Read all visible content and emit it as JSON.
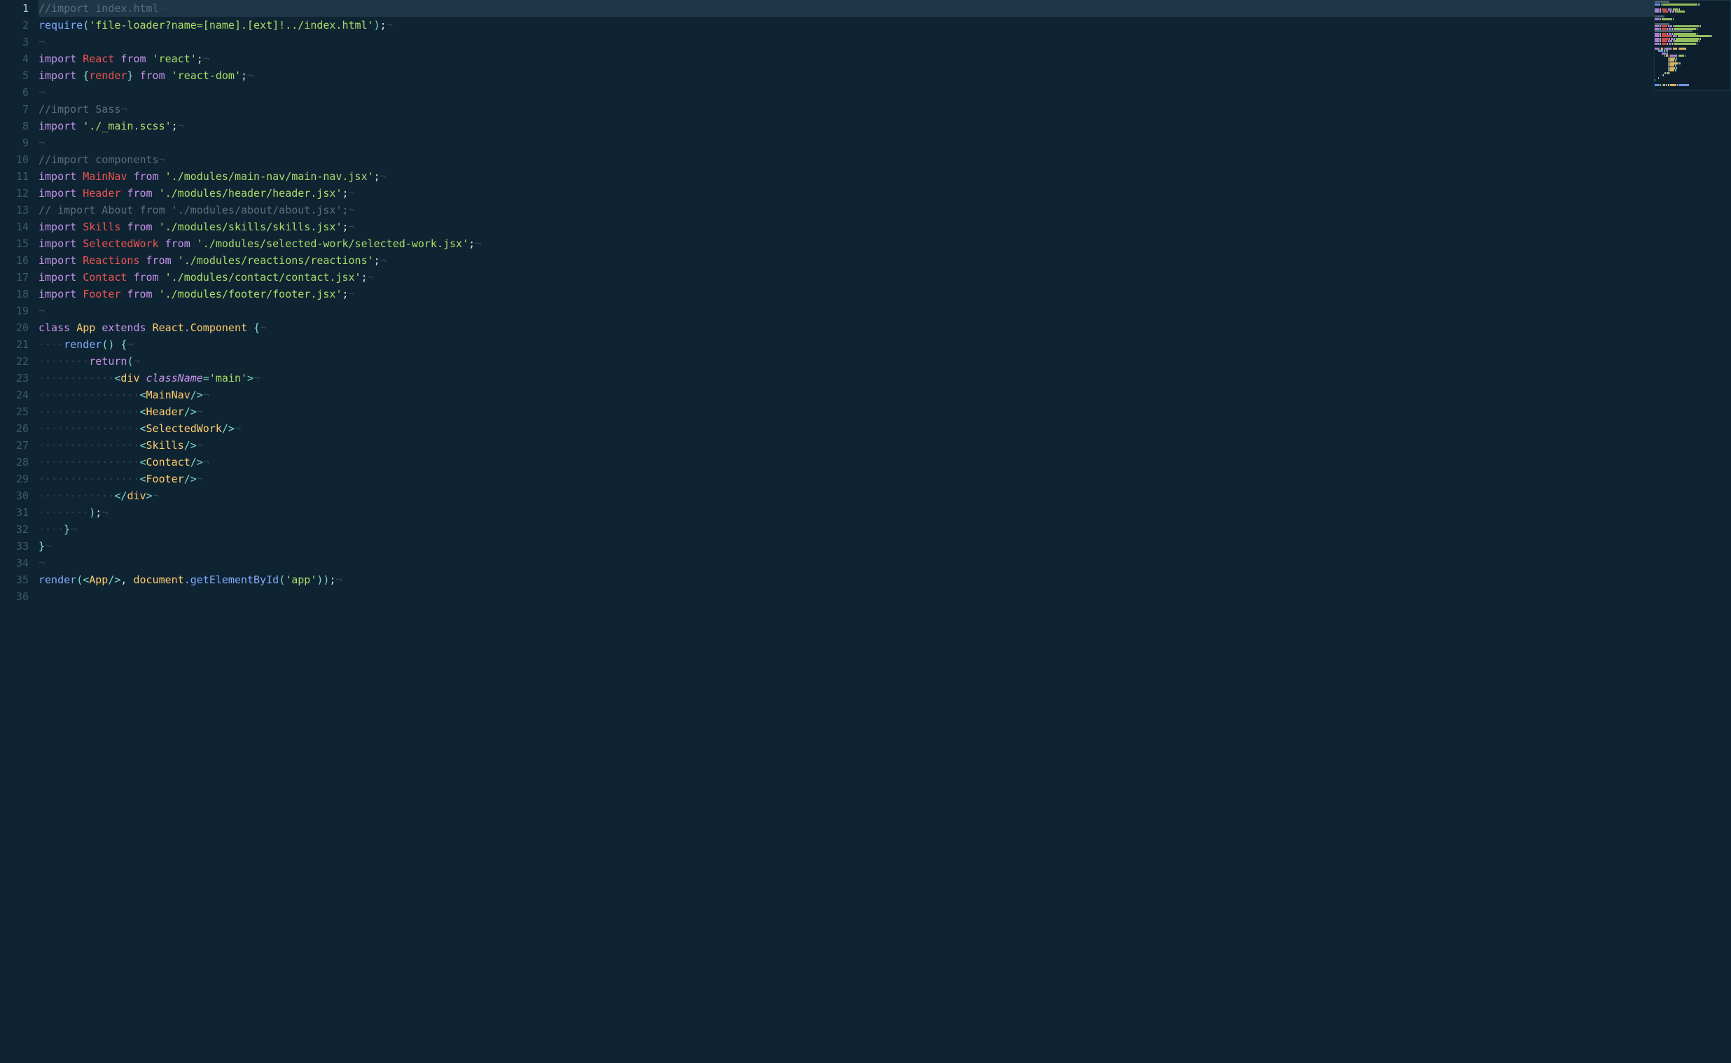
{
  "editor": {
    "activeLine": 1,
    "language": "javascript",
    "totalLines": 36
  },
  "lines": {
    "1": {
      "num": "1",
      "tokens": [
        [
          "c-comment",
          "//import index.html"
        ],
        [
          "c-eol",
          "¬"
        ]
      ]
    },
    "2": {
      "num": "2",
      "tokens": [
        [
          "c-func",
          "require"
        ],
        [
          "c-punct",
          "("
        ],
        [
          "c-string",
          "'file-loader?name=[name].[ext]!../index.html'"
        ],
        [
          "c-punct",
          ")"
        ],
        [
          "c-plain",
          ";"
        ],
        [
          "c-eol",
          "¬"
        ]
      ]
    },
    "3": {
      "num": "3",
      "tokens": [
        [
          "c-eol",
          "¬"
        ]
      ]
    },
    "4": {
      "num": "4",
      "tokens": [
        [
          "c-keyword",
          "import"
        ],
        [
          "c-plain",
          " "
        ],
        [
          "c-ident",
          "React"
        ],
        [
          "c-plain",
          " "
        ],
        [
          "c-keyword",
          "from"
        ],
        [
          "c-plain",
          " "
        ],
        [
          "c-string",
          "'react'"
        ],
        [
          "c-plain",
          ";"
        ],
        [
          "c-eol",
          "¬"
        ]
      ]
    },
    "5": {
      "num": "5",
      "tokens": [
        [
          "c-keyword",
          "import"
        ],
        [
          "c-plain",
          " "
        ],
        [
          "c-punct",
          "{"
        ],
        [
          "c-ident",
          "render"
        ],
        [
          "c-punct",
          "}"
        ],
        [
          "c-plain",
          " "
        ],
        [
          "c-keyword",
          "from"
        ],
        [
          "c-plain",
          " "
        ],
        [
          "c-string",
          "'react-dom'"
        ],
        [
          "c-plain",
          ";"
        ],
        [
          "c-eol",
          "¬"
        ]
      ]
    },
    "6": {
      "num": "6",
      "tokens": [
        [
          "c-eol",
          "¬"
        ]
      ]
    },
    "7": {
      "num": "7",
      "tokens": [
        [
          "c-comment",
          "//import Sass"
        ],
        [
          "c-eol",
          "¬"
        ]
      ]
    },
    "8": {
      "num": "8",
      "tokens": [
        [
          "c-keyword",
          "import"
        ],
        [
          "c-plain",
          " "
        ],
        [
          "c-string",
          "'./_main.scss'"
        ],
        [
          "c-plain",
          ";"
        ],
        [
          "c-eol",
          "¬"
        ]
      ]
    },
    "9": {
      "num": "9",
      "tokens": [
        [
          "c-eol",
          "¬"
        ]
      ]
    },
    "10": {
      "num": "10",
      "tokens": [
        [
          "c-comment",
          "//import components"
        ],
        [
          "c-eol",
          "¬"
        ]
      ]
    },
    "11": {
      "num": "11",
      "tokens": [
        [
          "c-keyword",
          "import"
        ],
        [
          "c-plain",
          " "
        ],
        [
          "c-ident",
          "MainNav"
        ],
        [
          "c-plain",
          " "
        ],
        [
          "c-keyword",
          "from"
        ],
        [
          "c-plain",
          " "
        ],
        [
          "c-string",
          "'./modules/main-nav/main-nav.jsx'"
        ],
        [
          "c-plain",
          ";"
        ],
        [
          "c-eol",
          "¬"
        ]
      ]
    },
    "12": {
      "num": "12",
      "tokens": [
        [
          "c-keyword",
          "import"
        ],
        [
          "c-plain",
          " "
        ],
        [
          "c-ident",
          "Header"
        ],
        [
          "c-plain",
          " "
        ],
        [
          "c-keyword",
          "from"
        ],
        [
          "c-plain",
          " "
        ],
        [
          "c-string",
          "'./modules/header/header.jsx'"
        ],
        [
          "c-plain",
          ";"
        ],
        [
          "c-eol",
          "¬"
        ]
      ]
    },
    "13": {
      "num": "13",
      "tokens": [
        [
          "c-comment",
          "// import About from './modules/about/about.jsx';"
        ],
        [
          "c-eol",
          "¬"
        ]
      ]
    },
    "14": {
      "num": "14",
      "tokens": [
        [
          "c-keyword",
          "import"
        ],
        [
          "c-plain",
          " "
        ],
        [
          "c-ident",
          "Skills"
        ],
        [
          "c-plain",
          " "
        ],
        [
          "c-keyword",
          "from"
        ],
        [
          "c-plain",
          " "
        ],
        [
          "c-string",
          "'./modules/skills/skills.jsx'"
        ],
        [
          "c-plain",
          ";"
        ],
        [
          "c-eol",
          "¬"
        ]
      ]
    },
    "15": {
      "num": "15",
      "tokens": [
        [
          "c-keyword",
          "import"
        ],
        [
          "c-plain",
          " "
        ],
        [
          "c-ident",
          "SelectedWork"
        ],
        [
          "c-plain",
          " "
        ],
        [
          "c-keyword",
          "from"
        ],
        [
          "c-plain",
          " "
        ],
        [
          "c-string",
          "'./modules/selected-work/selected-work.jsx'"
        ],
        [
          "c-plain",
          ";"
        ],
        [
          "c-eol",
          "¬"
        ]
      ]
    },
    "16": {
      "num": "16",
      "tokens": [
        [
          "c-keyword",
          "import"
        ],
        [
          "c-plain",
          " "
        ],
        [
          "c-ident",
          "Reactions"
        ],
        [
          "c-plain",
          " "
        ],
        [
          "c-keyword",
          "from"
        ],
        [
          "c-plain",
          " "
        ],
        [
          "c-string",
          "'./modules/reactions/reactions'"
        ],
        [
          "c-plain",
          ";"
        ],
        [
          "c-eol",
          "¬"
        ]
      ]
    },
    "17": {
      "num": "17",
      "tokens": [
        [
          "c-keyword",
          "import"
        ],
        [
          "c-plain",
          " "
        ],
        [
          "c-ident",
          "Contact"
        ],
        [
          "c-plain",
          " "
        ],
        [
          "c-keyword",
          "from"
        ],
        [
          "c-plain",
          " "
        ],
        [
          "c-string",
          "'./modules/contact/contact.jsx'"
        ],
        [
          "c-plain",
          ";"
        ],
        [
          "c-eol",
          "¬"
        ]
      ]
    },
    "18": {
      "num": "18",
      "tokens": [
        [
          "c-keyword",
          "import"
        ],
        [
          "c-plain",
          " "
        ],
        [
          "c-ident",
          "Footer"
        ],
        [
          "c-plain",
          " "
        ],
        [
          "c-keyword",
          "from"
        ],
        [
          "c-plain",
          " "
        ],
        [
          "c-string",
          "'./modules/footer/footer.jsx'"
        ],
        [
          "c-plain",
          ";"
        ],
        [
          "c-eol",
          "¬"
        ]
      ]
    },
    "19": {
      "num": "19",
      "tokens": [
        [
          "c-eol",
          "¬"
        ]
      ]
    },
    "20": {
      "num": "20",
      "tokens": [
        [
          "c-keyword",
          "class"
        ],
        [
          "c-plain",
          " "
        ],
        [
          "c-class",
          "App"
        ],
        [
          "c-plain",
          " "
        ],
        [
          "c-keyword",
          "extends"
        ],
        [
          "c-plain",
          " "
        ],
        [
          "c-class",
          "React"
        ],
        [
          "c-dot",
          "."
        ],
        [
          "c-class",
          "Component"
        ],
        [
          "c-plain",
          " "
        ],
        [
          "c-punct",
          "{"
        ],
        [
          "c-eol",
          "¬"
        ]
      ]
    },
    "21": {
      "num": "21",
      "tokens": [
        [
          "c-ws",
          "····"
        ],
        [
          "c-func",
          "render"
        ],
        [
          "c-punct",
          "()"
        ],
        [
          "c-plain",
          " "
        ],
        [
          "c-punct",
          "{"
        ],
        [
          "c-eol",
          "¬"
        ]
      ]
    },
    "22": {
      "num": "22",
      "tokens": [
        [
          "c-ws",
          "········"
        ],
        [
          "c-keyword",
          "return"
        ],
        [
          "c-punct",
          "("
        ],
        [
          "c-eol",
          "¬"
        ]
      ]
    },
    "23": {
      "num": "23",
      "tokens": [
        [
          "c-ws",
          "············"
        ],
        [
          "c-punct",
          "<"
        ],
        [
          "c-tag",
          "div"
        ],
        [
          "c-plain",
          " "
        ],
        [
          "c-attr",
          "className"
        ],
        [
          "c-punct",
          "="
        ],
        [
          "c-string",
          "'main'"
        ],
        [
          "c-punct",
          ">"
        ],
        [
          "c-eol",
          "¬"
        ]
      ]
    },
    "24": {
      "num": "24",
      "tokens": [
        [
          "c-ws",
          "················"
        ],
        [
          "c-punct",
          "<"
        ],
        [
          "c-tag",
          "MainNav"
        ],
        [
          "c-punct",
          "/>"
        ],
        [
          "c-eol",
          "¬"
        ]
      ]
    },
    "25": {
      "num": "25",
      "tokens": [
        [
          "c-ws",
          "················"
        ],
        [
          "c-punct",
          "<"
        ],
        [
          "c-tag",
          "Header"
        ],
        [
          "c-punct",
          "/>"
        ],
        [
          "c-eol",
          "¬"
        ]
      ]
    },
    "26": {
      "num": "26",
      "tokens": [
        [
          "c-ws",
          "················"
        ],
        [
          "c-punct",
          "<"
        ],
        [
          "c-tag",
          "SelectedWork"
        ],
        [
          "c-punct",
          "/>"
        ],
        [
          "c-eol",
          "¬"
        ]
      ]
    },
    "27": {
      "num": "27",
      "tokens": [
        [
          "c-ws",
          "················"
        ],
        [
          "c-punct",
          "<"
        ],
        [
          "c-tag",
          "Skills"
        ],
        [
          "c-punct",
          "/>"
        ],
        [
          "c-eol",
          "¬"
        ]
      ]
    },
    "28": {
      "num": "28",
      "tokens": [
        [
          "c-ws",
          "················"
        ],
        [
          "c-punct",
          "<"
        ],
        [
          "c-tag",
          "Contact"
        ],
        [
          "c-punct",
          "/>"
        ],
        [
          "c-eol",
          "¬"
        ]
      ]
    },
    "29": {
      "num": "29",
      "tokens": [
        [
          "c-ws",
          "················"
        ],
        [
          "c-punct",
          "<"
        ],
        [
          "c-tag",
          "Footer"
        ],
        [
          "c-punct",
          "/>"
        ],
        [
          "c-eol",
          "¬"
        ]
      ]
    },
    "30": {
      "num": "30",
      "tokens": [
        [
          "c-ws",
          "············"
        ],
        [
          "c-punct",
          "</"
        ],
        [
          "c-tag",
          "div"
        ],
        [
          "c-punct",
          ">"
        ],
        [
          "c-eol",
          "¬"
        ]
      ]
    },
    "31": {
      "num": "31",
      "tokens": [
        [
          "c-ws",
          "········"
        ],
        [
          "c-punct",
          ")"
        ],
        [
          "c-plain",
          ";"
        ],
        [
          "c-eol",
          "¬"
        ]
      ]
    },
    "32": {
      "num": "32",
      "tokens": [
        [
          "c-ws",
          "····"
        ],
        [
          "c-punct",
          "}"
        ],
        [
          "c-eol",
          "¬"
        ]
      ]
    },
    "33": {
      "num": "33",
      "tokens": [
        [
          "c-punct",
          "}"
        ],
        [
          "c-eol",
          "¬"
        ]
      ]
    },
    "34": {
      "num": "34",
      "tokens": [
        [
          "c-eol",
          "¬"
        ]
      ]
    },
    "35": {
      "num": "35",
      "tokens": [
        [
          "c-func",
          "render"
        ],
        [
          "c-punct",
          "("
        ],
        [
          "c-punct",
          "<"
        ],
        [
          "c-tag",
          "App"
        ],
        [
          "c-punct",
          "/>"
        ],
        [
          "c-plain",
          ", "
        ],
        [
          "c-class",
          "document"
        ],
        [
          "c-dot",
          "."
        ],
        [
          "c-func",
          "getElementById"
        ],
        [
          "c-punct",
          "("
        ],
        [
          "c-string",
          "'app'"
        ],
        [
          "c-punct",
          "))"
        ],
        [
          "c-plain",
          ";"
        ],
        [
          "c-eol",
          "¬"
        ]
      ]
    },
    "36": {
      "num": "36",
      "tokens": []
    }
  },
  "minimap": {
    "colors": {
      "comment": "#5a6e7a",
      "keyword": "#c792ea",
      "ident": "#ef5350",
      "string": "#addb67",
      "func": "#82aaff",
      "tag": "#ffcb6b"
    }
  }
}
